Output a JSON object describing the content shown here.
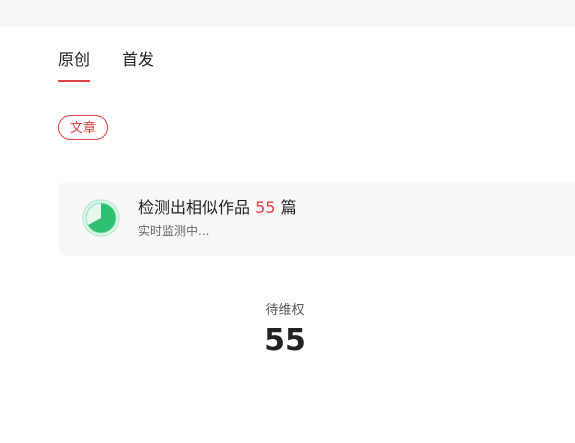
{
  "tabs": [
    {
      "label": "原创",
      "active": true
    },
    {
      "label": "首发",
      "active": false
    }
  ],
  "filter_chip": {
    "label": "文章"
  },
  "detection": {
    "prefix": "检测出相似作品",
    "count": "55",
    "suffix": "篇",
    "status": "实时监测中..."
  },
  "stat": {
    "label": "待维权",
    "value": "55"
  },
  "colors": {
    "accent": "#e0403f",
    "progress_green": "#2fbf71",
    "progress_light": "#b9ecd0"
  }
}
